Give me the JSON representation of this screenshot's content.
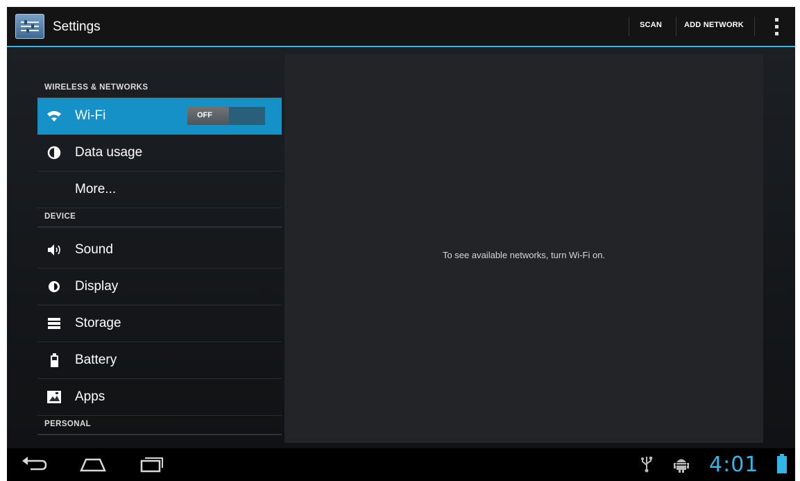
{
  "action_bar": {
    "title": "Settings",
    "icon": "settings-icon",
    "actions": {
      "scan": "SCAN",
      "add_network": "ADD NETWORK"
    },
    "overflow_icon": "overflow-menu-icon"
  },
  "sections": {
    "wireless": "WIRELESS & NETWORKS",
    "device": "DEVICE",
    "personal": "PERSONAL"
  },
  "items": {
    "wifi": {
      "label": "Wi-Fi",
      "icon": "wifi-icon",
      "toggle": "OFF",
      "selected": true
    },
    "data_usage": {
      "label": "Data usage",
      "icon": "data-usage-icon"
    },
    "more": {
      "label": "More..."
    },
    "sound": {
      "label": "Sound",
      "icon": "sound-icon"
    },
    "display": {
      "label": "Display",
      "icon": "display-icon"
    },
    "storage": {
      "label": "Storage",
      "icon": "storage-icon"
    },
    "battery": {
      "label": "Battery",
      "icon": "battery-icon"
    },
    "apps": {
      "label": "Apps",
      "icon": "apps-icon"
    }
  },
  "detail": {
    "message": "To see available networks, turn Wi-Fi on."
  },
  "system_bar": {
    "clock": "4:01",
    "nav": [
      "back-icon",
      "home-icon",
      "recent-apps-icon"
    ],
    "status": [
      "usb-icon",
      "android-debug-icon",
      "battery-status-icon"
    ]
  },
  "colors": {
    "accent": "#33b5e5",
    "selected": "#1591c7",
    "background": "#0c0c0c"
  }
}
